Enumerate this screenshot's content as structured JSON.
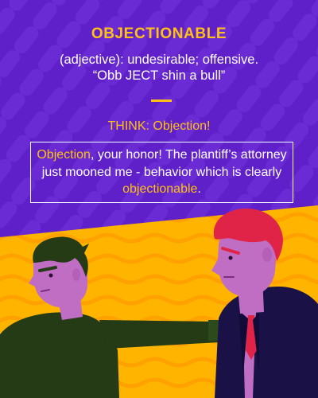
{
  "card": {
    "word": "OBJECTIONABLE",
    "definition": "(adjective): undesirable; offensive.",
    "pronunciation": "“Obb JECT shin a bull”",
    "think": "THINK: Objection!",
    "sentence": {
      "highlight_start": "Objection",
      "part_a": ", your honor! The plantiff’s attorney just mooned me - behavior which is clearly ",
      "highlight_end": "objectionable",
      "part_b": "."
    }
  },
  "colors": {
    "background_purple": "#5f1fc9",
    "background_yellow": "#ffb400",
    "accent_yellow": "#ffc114",
    "text_white": "#ffffff"
  },
  "illustration": {
    "left_person": "pointing-man-icon",
    "right_person": "red-haired-man-icon"
  }
}
